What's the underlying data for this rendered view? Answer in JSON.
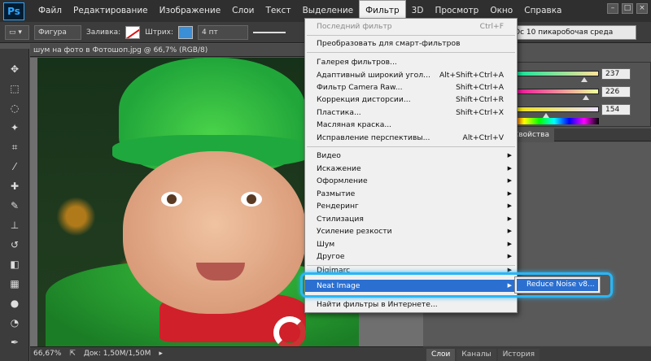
{
  "app": {
    "logo": "Ps"
  },
  "menubar": {
    "items": [
      "Файл",
      "Редактирование",
      "Изображение",
      "Слои",
      "Текст",
      "Выделение",
      "Фильтр",
      "3D",
      "Просмотр",
      "Окно",
      "Справка"
    ],
    "active": "Фильтр"
  },
  "options": {
    "shape_mode": "Фигура",
    "fill_label": "Заливка:",
    "stroke_label": "Штрих:",
    "stroke_width": "4 пт",
    "workspace": "Ос 10 пикаробочая среда",
    "accent_stroke": "#3a8fd6"
  },
  "document": {
    "tab_title": "шум на фото в Фотошоп.jpg @ 66,7% (RGB/8)",
    "zoom": "66,67%",
    "doc_info": "Док: 1,50M/1,50M"
  },
  "color_panel": {
    "r": "237",
    "g": "226",
    "b": "154"
  },
  "properties_tab": "Свойства",
  "bottom_tabs": [
    "Слои",
    "Каналы",
    "История"
  ],
  "filter_menu": {
    "last_filter": "Последний фильтр",
    "last_filter_shortcut": "Ctrl+F",
    "smart": "Преобразовать для смарт-фильтров",
    "gallery": "Галерея фильтров...",
    "adaptive": "Адаптивный широкий угол...",
    "adaptive_shortcut": "Alt+Shift+Ctrl+A",
    "camera_raw": "Фильтр Camera Raw...",
    "camera_raw_shortcut": "Shift+Ctrl+A",
    "lens": "Коррекция дисторсии...",
    "lens_shortcut": "Shift+Ctrl+R",
    "liquify": "Пластика...",
    "liquify_shortcut": "Shift+Ctrl+X",
    "oil": "Масляная краска...",
    "perspective": "Исправление перспективы...",
    "perspective_shortcut": "Alt+Ctrl+V",
    "sub": [
      "Видео",
      "Искажение",
      "Оформление",
      "Размытие",
      "Рендеринг",
      "Стилизация",
      "Усиление резкости",
      "Шум",
      "Другое"
    ],
    "digimarc": "Digimarc",
    "neat": "Neat Image",
    "browse": "Найти фильтры в Интернете..."
  },
  "submenu": {
    "item": "Reduce Noise v8..."
  },
  "colors": {
    "highlight": "#2b6fd1",
    "glow": "#29b6f6"
  }
}
